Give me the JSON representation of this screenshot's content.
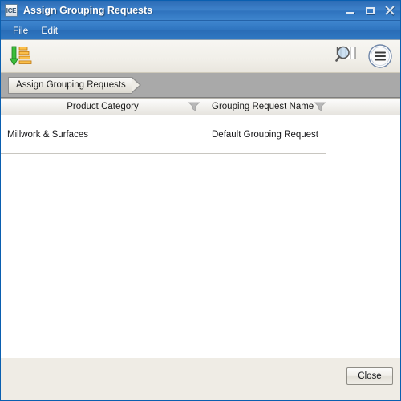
{
  "window": {
    "app_icon_label": "ICE",
    "title": "Assign Grouping Requests",
    "controls": {
      "minimize": "Minimize",
      "maximize": "Maximize",
      "close": "Close"
    }
  },
  "menubar": {
    "items": [
      {
        "label": "File"
      },
      {
        "label": "Edit"
      }
    ]
  },
  "toolbar": {
    "left_buttons": [
      {
        "name": "sort-apply-icon",
        "tooltip": "Apply"
      }
    ],
    "right_buttons": [
      {
        "name": "query-search-icon",
        "tooltip": "Search"
      },
      {
        "name": "menu-hamburger-icon",
        "tooltip": "Menu"
      }
    ]
  },
  "breadcrumb": {
    "items": [
      {
        "label": "Assign Grouping Requests"
      }
    ]
  },
  "table": {
    "columns": [
      {
        "key": "product_category",
        "label": "Product Category",
        "filter_icon": "funnel-icon"
      },
      {
        "key": "grouping_request_name",
        "label": "Grouping Request Name",
        "filter_icon": "funnel-icon"
      }
    ],
    "rows": [
      {
        "product_category": "Millwork & Surfaces",
        "grouping_request_name": "Default Grouping Request"
      }
    ]
  },
  "footer": {
    "close_label": "Close"
  },
  "colors": {
    "titlebar_blue": "#3d80c9",
    "window_border": "#0a5fb0",
    "toolbar_bg": "#f1efe9",
    "breadcrumb_bar": "#a9a9a9",
    "panel_bg": "#efece5",
    "accent_green": "#2ea02e",
    "accent_orange": "#f0a830"
  }
}
